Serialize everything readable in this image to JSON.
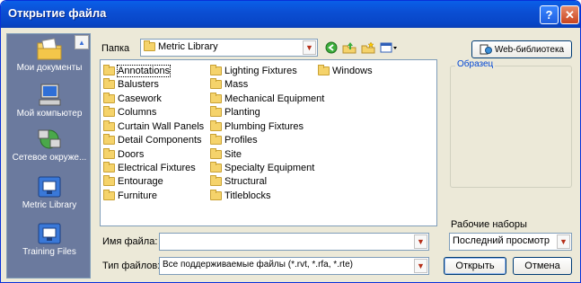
{
  "window": {
    "title": "Открытие файла"
  },
  "titlebar": {
    "help_glyph": "?",
    "close_glyph": "✕"
  },
  "places": [
    {
      "label": "Мои документы",
      "icon": "my-documents-icon"
    },
    {
      "label": "Мой компьютер",
      "icon": "my-computer-icon"
    },
    {
      "label": "Сетевое окруже...",
      "icon": "network-places-icon"
    },
    {
      "label": "Metric Library",
      "icon": "library-icon"
    },
    {
      "label": "Training Files",
      "icon": "library-icon"
    }
  ],
  "lookin": {
    "label": "Папка",
    "value": "Metric Library"
  },
  "web_library": {
    "label": "Web-библиотека"
  },
  "preview": {
    "title": "Образец"
  },
  "files": [
    "Annotations",
    "Balusters",
    "Casework",
    "Columns",
    "Curtain Wall Panels",
    "Detail Components",
    "Doors",
    "Electrical Fixtures",
    "Entourage",
    "Furniture",
    "Lighting Fixtures",
    "Mass",
    "Mechanical Equipment",
    "Planting",
    "Plumbing Fixtures",
    "Profiles",
    "Site",
    "Specialty Equipment",
    "Structural",
    "Titleblocks",
    "Windows"
  ],
  "filename": {
    "label": "Имя файла:",
    "value": ""
  },
  "filetype": {
    "label": "Тип файлов:",
    "value": "Все поддерживаемые файлы (*.rvt, *.rfa, *.rte)"
  },
  "worksets": {
    "label": "Рабочие наборы",
    "value": "Последний просмотр"
  },
  "buttons": {
    "open": "Открыть",
    "cancel": "Отмена"
  }
}
